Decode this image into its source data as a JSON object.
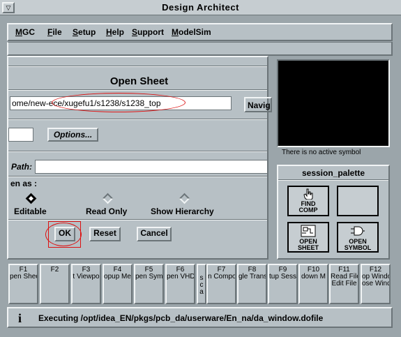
{
  "window": {
    "title": "Design Architect",
    "menu_glyph": "▽"
  },
  "menubar": {
    "items": [
      {
        "label": "MGC",
        "key": "M"
      },
      {
        "label": "File",
        "key": "F"
      },
      {
        "label": "Setup",
        "key": "S"
      },
      {
        "label": "Help",
        "key": "H"
      },
      {
        "label": "Support",
        "key": "S"
      },
      {
        "label": "ModelSim",
        "key": "M"
      }
    ]
  },
  "dialog": {
    "title": "Open Sheet",
    "path_value": "ome/new-ece/xugefu1/s1238/s1238_top",
    "navigator_label": "Navig",
    "options_label": "Options...",
    "path_label": "Path:",
    "open_as_label": "en as :",
    "radios": [
      {
        "label": "Editable",
        "selected": true
      },
      {
        "label": "Read Only",
        "selected": false
      },
      {
        "label": "Show Hierarchy",
        "selected": false
      }
    ],
    "ok_label": "OK",
    "reset_label": "Reset",
    "cancel_label": "Cancel"
  },
  "symbol_panel": {
    "message": "There is no active symbol"
  },
  "session_palette": {
    "title": "session_palette",
    "buttons": [
      {
        "line1": "FIND",
        "line2": "COMP",
        "icon": "hand-pointer-icon"
      },
      {
        "line1": "",
        "line2": "",
        "icon": ""
      },
      {
        "line1": "OPEN",
        "line2": "SHEET",
        "icon": "schematic-sheet-icon"
      },
      {
        "line1": "OPEN",
        "line2": "SYMBOL",
        "icon": "and-gate-symbol-icon"
      }
    ]
  },
  "function_keys": [
    {
      "key": "F1",
      "line1": "pen Shee",
      "line2": ""
    },
    {
      "key": "F2",
      "line1": "",
      "line2": ""
    },
    {
      "key": "F3",
      "line1": "t Viewpo",
      "line2": ""
    },
    {
      "key": "F4",
      "line1": "opup Me",
      "line2": ""
    },
    {
      "key": "F5",
      "line1": "pen Symb",
      "line2": ""
    },
    {
      "key": "F6",
      "line1": "pen VHD",
      "line2": ""
    },
    {
      "key": "",
      "line1": "s",
      "line2": "c",
      "line3": "a"
    },
    {
      "key": "F7",
      "line1": "n Compo",
      "line2": ""
    },
    {
      "key": "F8",
      "line1": "gle Trans",
      "line2": ""
    },
    {
      "key": "F9",
      "line1": "tup Sess",
      "line2": ""
    },
    {
      "key": "F10",
      "line1": "down M",
      "line2": ""
    },
    {
      "key": "F11",
      "line1": "Read File",
      "line2": "Edit File"
    },
    {
      "key": "F12",
      "line1": "op Windo",
      "line2": "ose Windo"
    }
  ],
  "status": {
    "icon": "info-icon",
    "glyph": "i",
    "text": "Executing /opt/idea_EN/pkgs/pcb_da/userware/En_na/da_window.dofile"
  },
  "colors": {
    "chrome": "#c6cdd1",
    "panel": "#b7c0c5",
    "frame": "#9ba5aa",
    "annotation": "#d11111"
  }
}
